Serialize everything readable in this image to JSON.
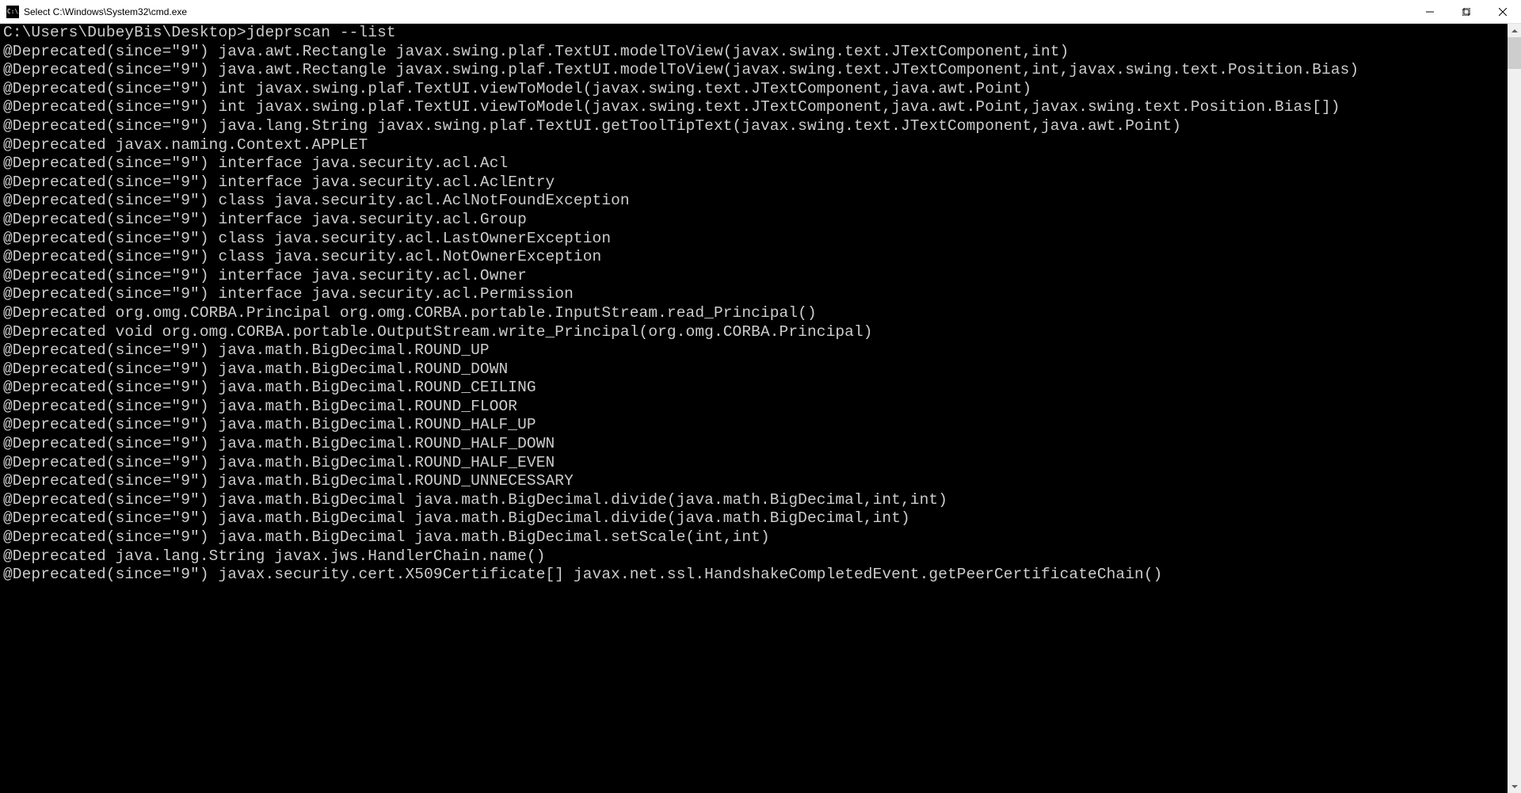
{
  "titlebar": {
    "icon_label": "C:\\",
    "title": "Select C:\\Windows\\System32\\cmd.exe"
  },
  "terminal": {
    "prompt": "C:\\Users\\DubeyBis\\Desktop>",
    "command": "jdeprscan --list",
    "lines": [
      "@Deprecated(since=\"9\") java.awt.Rectangle javax.swing.plaf.TextUI.modelToView(javax.swing.text.JTextComponent,int)",
      "@Deprecated(since=\"9\") java.awt.Rectangle javax.swing.plaf.TextUI.modelToView(javax.swing.text.JTextComponent,int,javax.swing.text.Position.Bias)",
      "@Deprecated(since=\"9\") int javax.swing.plaf.TextUI.viewToModel(javax.swing.text.JTextComponent,java.awt.Point)",
      "@Deprecated(since=\"9\") int javax.swing.plaf.TextUI.viewToModel(javax.swing.text.JTextComponent,java.awt.Point,javax.swing.text.Position.Bias[])",
      "@Deprecated(since=\"9\") java.lang.String javax.swing.plaf.TextUI.getToolTipText(javax.swing.text.JTextComponent,java.awt.Point)",
      "@Deprecated javax.naming.Context.APPLET",
      "@Deprecated(since=\"9\") interface java.security.acl.Acl",
      "@Deprecated(since=\"9\") interface java.security.acl.AclEntry",
      "@Deprecated(since=\"9\") class java.security.acl.AclNotFoundException",
      "@Deprecated(since=\"9\") interface java.security.acl.Group",
      "@Deprecated(since=\"9\") class java.security.acl.LastOwnerException",
      "@Deprecated(since=\"9\") class java.security.acl.NotOwnerException",
      "@Deprecated(since=\"9\") interface java.security.acl.Owner",
      "@Deprecated(since=\"9\") interface java.security.acl.Permission",
      "@Deprecated org.omg.CORBA.Principal org.omg.CORBA.portable.InputStream.read_Principal()",
      "@Deprecated void org.omg.CORBA.portable.OutputStream.write_Principal(org.omg.CORBA.Principal)",
      "@Deprecated(since=\"9\") java.math.BigDecimal.ROUND_UP",
      "@Deprecated(since=\"9\") java.math.BigDecimal.ROUND_DOWN",
      "@Deprecated(since=\"9\") java.math.BigDecimal.ROUND_CEILING",
      "@Deprecated(since=\"9\") java.math.BigDecimal.ROUND_FLOOR",
      "@Deprecated(since=\"9\") java.math.BigDecimal.ROUND_HALF_UP",
      "@Deprecated(since=\"9\") java.math.BigDecimal.ROUND_HALF_DOWN",
      "@Deprecated(since=\"9\") java.math.BigDecimal.ROUND_HALF_EVEN",
      "@Deprecated(since=\"9\") java.math.BigDecimal.ROUND_UNNECESSARY",
      "@Deprecated(since=\"9\") java.math.BigDecimal java.math.BigDecimal.divide(java.math.BigDecimal,int,int)",
      "@Deprecated(since=\"9\") java.math.BigDecimal java.math.BigDecimal.divide(java.math.BigDecimal,int)",
      "@Deprecated(since=\"9\") java.math.BigDecimal java.math.BigDecimal.setScale(int,int)",
      "@Deprecated java.lang.String javax.jws.HandlerChain.name()",
      "@Deprecated(since=\"9\") javax.security.cert.X509Certificate[] javax.net.ssl.HandshakeCompletedEvent.getPeerCertificateChain()"
    ]
  }
}
